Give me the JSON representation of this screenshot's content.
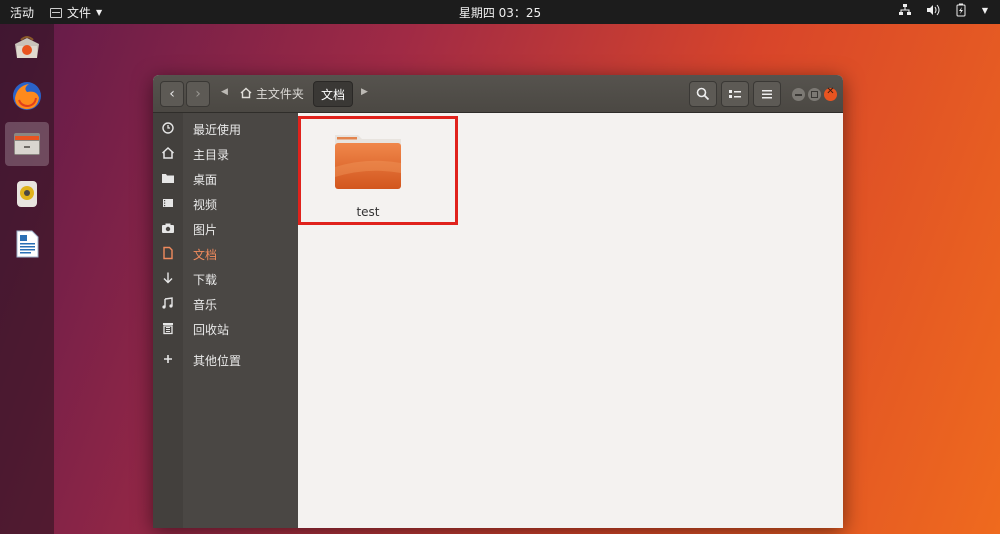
{
  "topbar": {
    "activities": "活动",
    "app_menu": "文件",
    "clock": "星期四 03：25"
  },
  "dock": {
    "items": [
      "ubuntu-software-icon",
      "firefox-icon",
      "files-icon",
      "rhythmbox-icon",
      "libreoffice-writer-icon"
    ],
    "active_index": 2
  },
  "window": {
    "breadcrumbs": [
      {
        "label": "主文件夹",
        "icon": "home-icon"
      },
      {
        "label": "文档",
        "current": true
      }
    ],
    "sidebar": {
      "items": [
        {
          "label": "最近使用",
          "icon": "clock-icon"
        },
        {
          "label": "主目录",
          "icon": "home-icon"
        },
        {
          "label": "桌面",
          "icon": "folder-icon"
        },
        {
          "label": "视频",
          "icon": "video-icon"
        },
        {
          "label": "图片",
          "icon": "camera-icon"
        },
        {
          "label": "文档",
          "icon": "document-icon",
          "active": true
        },
        {
          "label": "下载",
          "icon": "download-icon"
        },
        {
          "label": "音乐",
          "icon": "music-icon"
        },
        {
          "label": "回收站",
          "icon": "trash-icon"
        },
        {
          "label": "其他位置",
          "icon": "plus-icon"
        }
      ]
    },
    "files": [
      {
        "name": "test",
        "type": "folder"
      }
    ]
  },
  "colors": {
    "accent": "#f08a5d",
    "highlight": "#e0221c",
    "close_button": "#e95420"
  }
}
